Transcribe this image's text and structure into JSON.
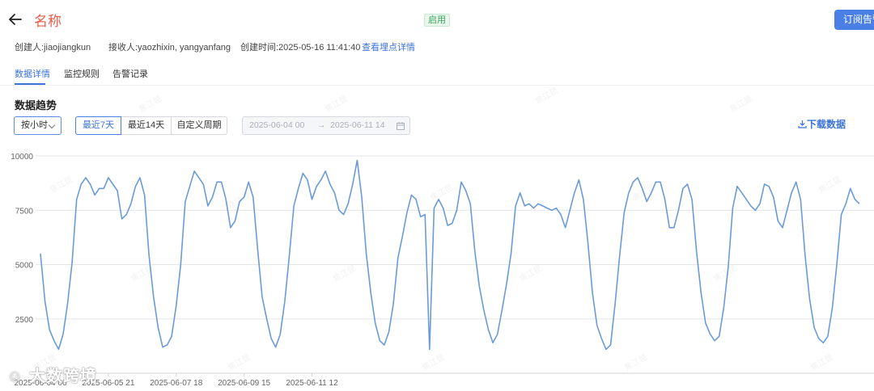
{
  "header": {
    "title": "名称",
    "status_badge": "启用",
    "subscribe_button": "订阅告警"
  },
  "meta": {
    "creator": "创建人:jiaojiangkun",
    "receivers": "接收人:yaozhixin, yangyanfang",
    "created_time": "创建时间:2025-05-16 11:41:40",
    "view_detail_link": "查看埋点详情"
  },
  "tabs": [
    {
      "label": "数据详情",
      "active": true
    },
    {
      "label": "监控规则",
      "active": false
    },
    {
      "label": "告警记录",
      "active": false
    }
  ],
  "section_title": "数据趋势",
  "controls": {
    "granularity_select": "按小时",
    "range_buttons": [
      {
        "label": "最近7天",
        "active": true
      },
      {
        "label": "最近14天",
        "active": false
      },
      {
        "label": "自定义周期",
        "active": false
      }
    ],
    "date_start": "2025-06-04 00",
    "date_end": "2025-06-11 14",
    "download_button": "下载数据"
  },
  "watermark": "焦江昆",
  "corner_logo": "大数跨境",
  "colors": {
    "accent": "#3b73d8",
    "title_red": "#e85c4a",
    "line": "#6a9bd8",
    "grid": "#e4e6ea"
  },
  "chart_data": {
    "type": "line",
    "ylim": [
      0,
      10000
    ],
    "yticks": [
      "10000",
      "7500",
      "5000",
      "2500"
    ],
    "xticks": [
      "2025-06-04 00",
      "2025-06-05 21",
      "2025-06-07 18",
      "2025-06-09 15",
      "2025-06-11 12"
    ],
    "interval_hours": 3,
    "series": [
      {
        "values": [
          5500,
          3300,
          2000,
          1500,
          1100,
          1800,
          3200,
          5100,
          8000,
          8700,
          9000,
          8700,
          8200,
          8500,
          8500,
          9000,
          8700,
          8400,
          7100,
          7300,
          7800,
          8600,
          9000,
          8200,
          5400,
          3500,
          2100,
          1200,
          1300,
          1700,
          3100,
          5000,
          7900,
          8600,
          9300,
          9000,
          8700,
          7700,
          8100,
          8800,
          8800,
          8000,
          6700,
          7000,
          7900,
          8100,
          8800,
          8100,
          5700,
          3500,
          2500,
          1600,
          1200,
          1800,
          3300,
          5400,
          7700,
          8500,
          9200,
          8900,
          8000,
          8600,
          8900,
          9300,
          8700,
          8300,
          7500,
          7300,
          7800,
          8700,
          9800,
          8100,
          5500,
          3700,
          2300,
          1500,
          1300,
          1900,
          3200,
          5300,
          6300,
          7400,
          8200,
          8000,
          7200,
          7300,
          1100,
          7600,
          8000,
          7600,
          6800,
          6900,
          7500,
          8800,
          8400,
          7800,
          5600,
          4000,
          2900,
          2000,
          1400,
          1800,
          2900,
          4100,
          5500,
          7700,
          8300,
          7700,
          7800,
          7600,
          7800,
          7700,
          7600,
          7500,
          7600,
          7300,
          6700,
          7500,
          8300,
          8900,
          8000,
          6000,
          3700,
          2200,
          1600,
          1100,
          1300,
          3200,
          5400,
          7400,
          8300,
          8800,
          9000,
          8500,
          7900,
          8300,
          8800,
          8800,
          8000,
          6700,
          6700,
          7500,
          8500,
          8700,
          8000,
          5600,
          3700,
          2300,
          1800,
          1500,
          1700,
          3000,
          4900,
          7600,
          8600,
          8300,
          8000,
          7700,
          7500,
          7800,
          8700,
          8600,
          8100,
          7000,
          6700,
          7500,
          8300,
          8800,
          8000,
          5400,
          3400,
          2100,
          1600,
          1400,
          1700,
          3000,
          5000,
          7300,
          7800,
          8500,
          8000,
          7800
        ]
      }
    ]
  }
}
